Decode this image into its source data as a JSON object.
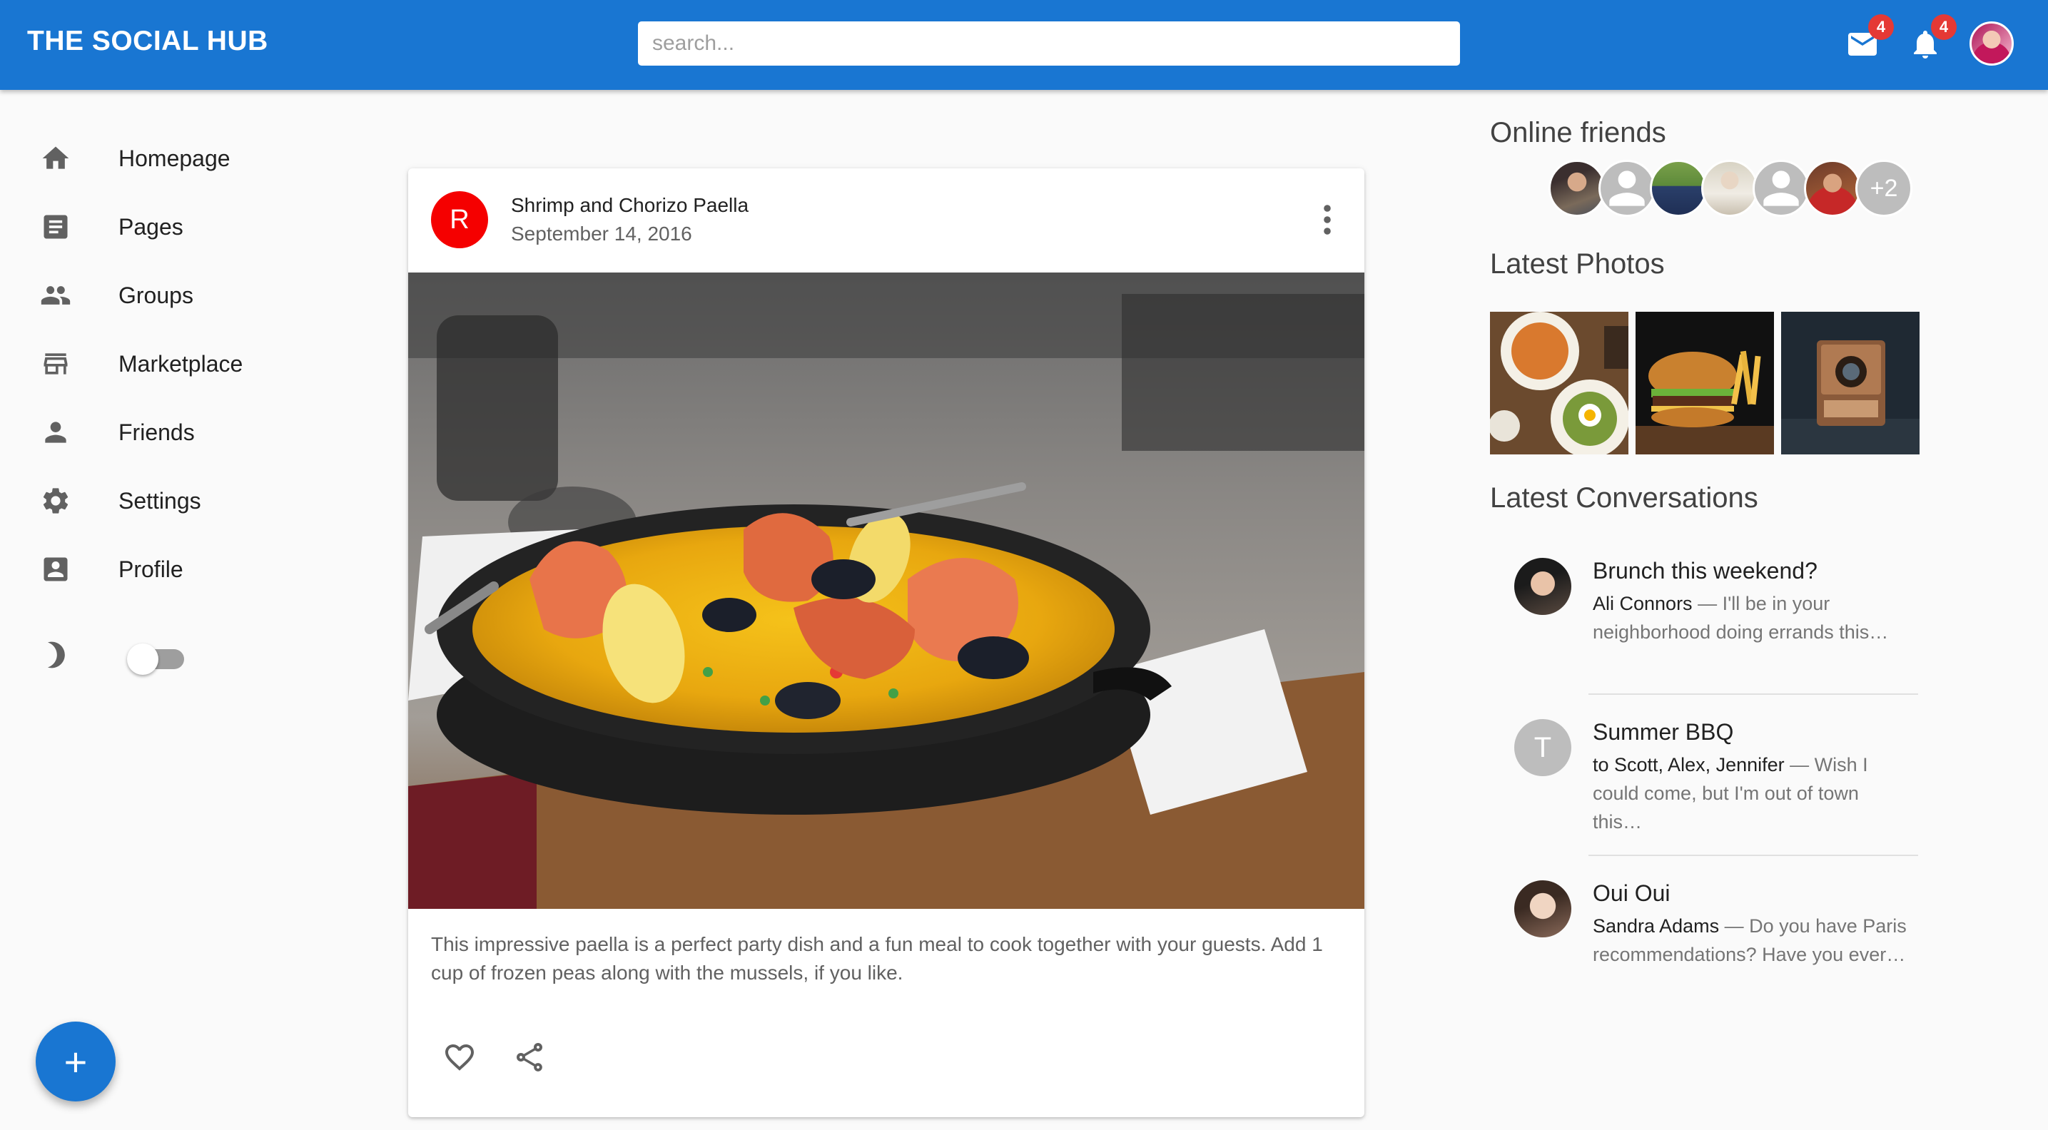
{
  "app": {
    "title": "THE SOCIAL HUB"
  },
  "search": {
    "placeholder": "search...",
    "value": ""
  },
  "header": {
    "mail_badge": "4",
    "notifications_badge": "4",
    "icons": {
      "mail": "mail-icon",
      "notifications": "bell-icon",
      "avatar": "user-avatar"
    }
  },
  "sidebar": {
    "items": [
      {
        "label": "Homepage",
        "icon": "home-icon"
      },
      {
        "label": "Pages",
        "icon": "document-icon"
      },
      {
        "label": "Groups",
        "icon": "people-icon"
      },
      {
        "label": "Marketplace",
        "icon": "store-icon"
      },
      {
        "label": "Friends",
        "icon": "person-icon"
      },
      {
        "label": "Settings",
        "icon": "gear-icon"
      },
      {
        "label": "Profile",
        "icon": "account-box-icon"
      }
    ],
    "dark_mode": {
      "icon": "moon-icon",
      "enabled": false
    }
  },
  "fab": {
    "label": "+"
  },
  "post": {
    "avatar_letter": "R",
    "title": "Shrimp and Chorizo Paella",
    "date": "September 14, 2016",
    "text": "This impressive paella is a perfect party dish and a fun meal to cook together with your guests. Add 1 cup of frozen peas along with the mussels, if you like.",
    "actions": [
      "heart-icon",
      "share-icon"
    ]
  },
  "right": {
    "online_title": "Online friends",
    "online_more": "+2",
    "photos_title": "Latest Photos",
    "conversations_title": "Latest Conversations",
    "conversations": [
      {
        "title": "Brunch this weekend?",
        "who": "Ali Connors",
        "snippet": " — I'll be in your neighborhood doing errands this…"
      },
      {
        "title": "Summer BBQ",
        "who": "to Scott, Alex, Jennifer",
        "snippet": " — Wish I could come, but I'm out of town this…",
        "avatar_letter": "T"
      },
      {
        "title": "Oui Oui",
        "who": "Sandra Adams",
        "snippet": " — Do you have Paris recommendations? Have you ever…"
      }
    ]
  },
  "colors": {
    "primary": "#1976d2",
    "badge": "#e53935",
    "post_avatar": "#f50000"
  }
}
